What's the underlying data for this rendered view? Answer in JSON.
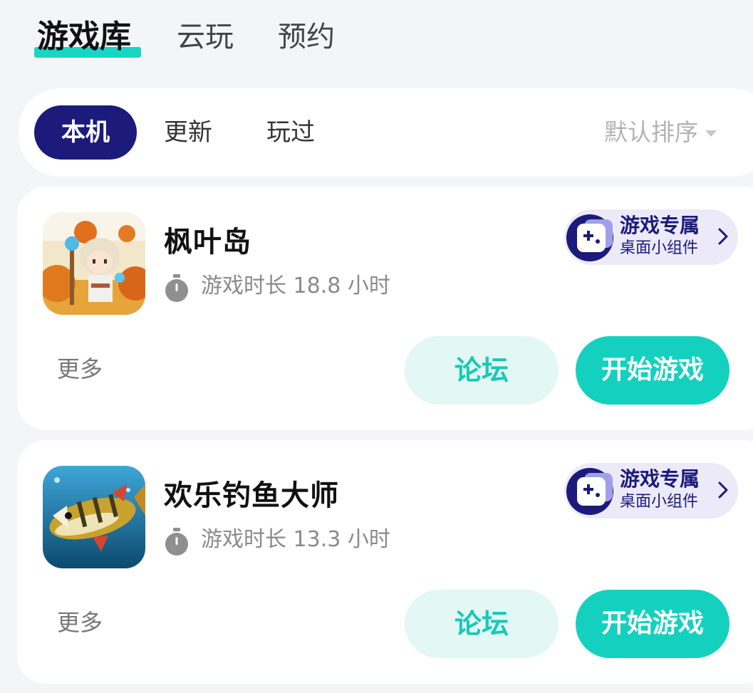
{
  "top_tabs": [
    {
      "label": "游戏库",
      "active": true
    },
    {
      "label": "云玩",
      "active": false
    },
    {
      "label": "预约",
      "active": false
    }
  ],
  "filters": [
    {
      "label": "本机",
      "active": true
    },
    {
      "label": "更新",
      "active": false
    },
    {
      "label": "玩过",
      "active": false
    }
  ],
  "sort": {
    "label": "默认排序",
    "icon": "caret-down-icon"
  },
  "games": [
    {
      "name": "枫叶岛",
      "icon": "maple-island-game-icon",
      "playtime": "游戏时长 18.8 小时",
      "widget": {
        "title": "游戏专属",
        "subtitle": "桌面小组件"
      },
      "more": "更多",
      "forum": "论坛",
      "play": "开始游戏"
    },
    {
      "name": "欢乐钓鱼大师",
      "icon": "fishing-master-game-icon",
      "playtime": "游戏时长 13.3 小时",
      "widget": {
        "title": "游戏专属",
        "subtitle": "桌面小组件"
      },
      "more": "更多",
      "forum": "论坛",
      "play": "开始游戏"
    }
  ],
  "colors": {
    "accent": "#14d1bf",
    "navy": "#1c1a7a",
    "background": "#f4f5f7"
  }
}
